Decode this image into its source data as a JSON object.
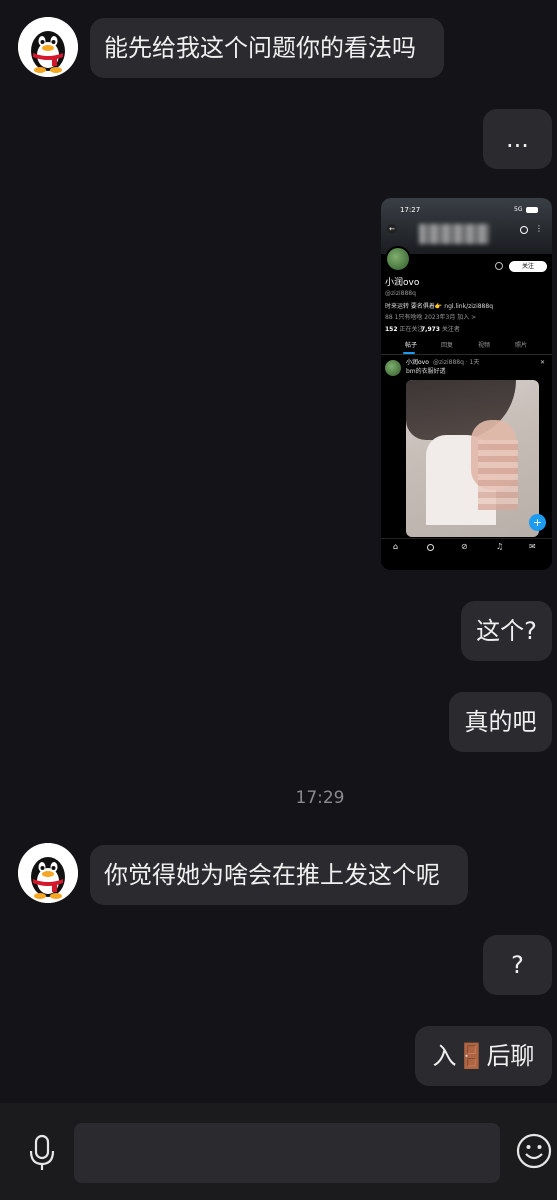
{
  "messages": {
    "m1": "能先给我这个问题你的看法吗",
    "m2": "...",
    "m3": "这个?",
    "m4": "真的吧",
    "time": "17:29",
    "m5": "你觉得她为啥会在推上发这个呢",
    "m6": "?",
    "m7_before": "入",
    "m7_emoji": "🚪",
    "m7_after": "后聊"
  },
  "shot": {
    "status_time": "17:27",
    "status_net": "5G",
    "follow_label": "关注",
    "profile_name": "小润ovo",
    "profile_handle": "@zizi888q",
    "bio": "时来运转 要名俱着👉 ngl.link/zizi888q",
    "meta": "88 1只有啥啥  2023年3月 加入 >",
    "following": "152",
    "following_label": "正在关注",
    "followers": "7,973",
    "followers_label": "关注者",
    "tabs": [
      "帖子",
      "回复",
      "视频",
      "照片"
    ],
    "post_name": "小润ovo",
    "post_handle": "@zizi888q · 1天",
    "post_text": "bm的衣服好透",
    "fab": "+"
  },
  "colors": {
    "background": "#141418",
    "bubble": "#2b2b2f",
    "accent": "#1d9bf0"
  }
}
